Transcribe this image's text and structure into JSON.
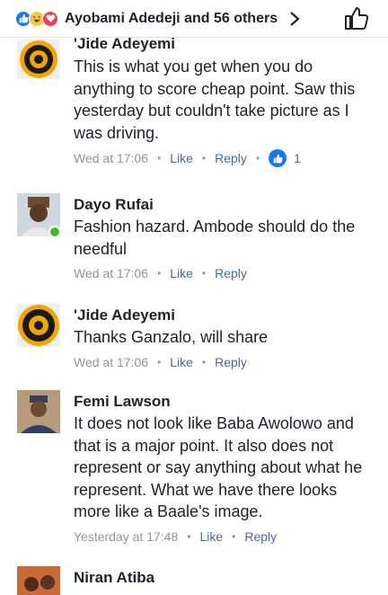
{
  "header": {
    "title": "Ayobami Adedeji and 56 others",
    "reactions": [
      "like-icon",
      "haha-icon",
      "love-icon"
    ]
  },
  "comments": [
    {
      "author": "'Jide Adeyemi",
      "text": "This is what you get when you do anything to score cheap point. Saw this yesterday but couldn't take picture as I was driving.",
      "time": "Wed at 17:06",
      "like": "Like",
      "reply": "Reply",
      "reaction_count": "1"
    },
    {
      "author": "Dayo Rufai",
      "text": "Fashion hazard. Ambode should do the needful",
      "time": "Wed at 17:06",
      "like": "Like",
      "reply": "Reply"
    },
    {
      "author": "'Jide Adeyemi",
      "text": "Thanks Ganzalo, will share",
      "time": "Wed at 17:06",
      "like": "Like",
      "reply": "Reply"
    },
    {
      "author": "Femi Lawson",
      "text": "It does not look like Baba Awolowo and that is a major point. It also does not represent or say anything about what he represent. What we have there looks more like a Baale's image.",
      "time": "Yesterday at 17:48",
      "like": "Like",
      "reply": "Reply"
    },
    {
      "author": "Niran Atiba"
    }
  ],
  "colors": {
    "accent": "#1877f2",
    "link": "#4b67a1",
    "meta": "#90949c",
    "online": "#42b72a"
  }
}
